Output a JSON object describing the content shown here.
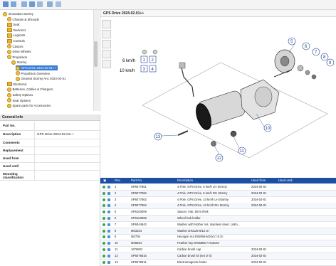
{
  "toolbar": {
    "icons": [
      "grid-view-icon",
      "list-view-icon",
      "print-icon",
      "export-icon",
      "settings-icon",
      "zoom-icon",
      "search-icon"
    ]
  },
  "tree": {
    "nodes": [
      {
        "label": "Innovation Stormy",
        "indent": 0
      },
      {
        "label": "Chassis & Shrouds",
        "indent": 1
      },
      {
        "label": "Seat",
        "indent": 1
      },
      {
        "label": "Deckrest",
        "indent": 1
      },
      {
        "label": "Legrests",
        "indent": 1
      },
      {
        "label": "Controls",
        "indent": 1
      },
      {
        "label": "Castors",
        "indent": 1
      },
      {
        "label": "Drive Wheels",
        "indent": 1
      },
      {
        "label": "Propulsion",
        "indent": 1
      },
      {
        "label": "Stormy",
        "indent": 2
      },
      {
        "label": "GPS Drive 2024-02-01++",
        "indent": 3,
        "selected": true
      },
      {
        "label": "Propulsion Overview",
        "indent": 3
      },
      {
        "label": "Gearset Stormy Anc 2024-02-01",
        "indent": 3
      },
      {
        "label": "Electronic",
        "indent": 1
      },
      {
        "label": "Batteries, Cables & Chargers",
        "indent": 1
      },
      {
        "label": "Safety Options",
        "indent": 1
      },
      {
        "label": "Seat Options",
        "indent": 1
      },
      {
        "label": "Spare parts for Accessories",
        "indent": 1
      }
    ]
  },
  "info": {
    "title": "General info",
    "rows": [
      {
        "label": "Part No.",
        "value": ""
      },
      {
        "label": "Description",
        "value": "GPS Drive 2024-02-01++"
      },
      {
        "label": "Comments",
        "value": ""
      },
      {
        "label": "Replacement",
        "value": ""
      },
      {
        "label": "Used from",
        "value": ""
      },
      {
        "label": "Used until",
        "value": ""
      },
      {
        "label": "Mounting classification",
        "value": ""
      }
    ]
  },
  "drawing": {
    "title": "GPS Drive 2024-02-01++",
    "speed_labels": [
      "6 km/h",
      "10 km/h"
    ],
    "callouts": [
      "1",
      "2",
      "3",
      "4",
      "5",
      "6",
      "7",
      "8",
      "9",
      "10",
      "11",
      "12",
      "13"
    ],
    "tool_icons": [
      "select-tool-icon",
      "zoom-in-icon",
      "zoom-out-icon",
      "fit-icon",
      "pan-icon"
    ]
  },
  "table": {
    "headers": [
      "Pos.",
      "Part No.",
      "Description",
      "Used from",
      "Used until"
    ],
    "rows": [
      {
        "pos": "1",
        "part": "SP6077861",
        "desc": "4 Pole, GPS Drive, 6 km/h LH Stormy",
        "from": "2024-02-01"
      },
      {
        "pos": "2",
        "part": "SP6077862",
        "desc": "4 Pole, GPS Drive, 6 km/h RH Stormy",
        "from": "2024-02-01"
      },
      {
        "pos": "3",
        "part": "SP6077863",
        "desc": "4 Pole, GPS Drive, 10 km/h LH Stormy",
        "from": "2024-02-01"
      },
      {
        "pos": "4",
        "part": "SP6077864",
        "desc": "4 Pole, GPS Drive, 10 km/h RH Stormy",
        "from": "2024-02-01"
      },
      {
        "pos": "5",
        "part": "SP6163009",
        "desc": "Spacer, hub, 5mm thick",
        "from": ""
      },
      {
        "pos": "6",
        "part": "SP6163006",
        "desc": "Wheel hub holder",
        "from": ""
      },
      {
        "pos": "7",
        "part": "SP6044942",
        "desc": "Washer with Nother nut, stainless steel, 1x8m...",
        "from": ""
      },
      {
        "pos": "8",
        "part": "I803104",
        "desc": "Washer DIN125-8/12 zn",
        "from": ""
      },
      {
        "pos": "9",
        "part": "I50705",
        "desc": "Hexagon nut DIN985-M10x17,8 zn",
        "from": ""
      },
      {
        "pos": "10",
        "part": "I606504",
        "desc": "Feather key DIN6885-A-6x6x40",
        "from": ""
      },
      {
        "pos": "11",
        "part": "1676822",
        "desc": "Carbon brush cap",
        "from": "2024-02-01"
      },
      {
        "pos": "12",
        "part": "SP6076816",
        "desc": "Carbon brush kit (set of 4)",
        "from": "2024-02-01"
      },
      {
        "pos": "13",
        "part": "SP6076811",
        "desc": "Electromagnetic brake",
        "from": "2024-02-01"
      }
    ]
  },
  "colors": {
    "header_blue": "#1b4fa2",
    "callout_blue": "#1e3d8f",
    "select_blue": "#3a7bd5",
    "folder": "#e8b634"
  }
}
